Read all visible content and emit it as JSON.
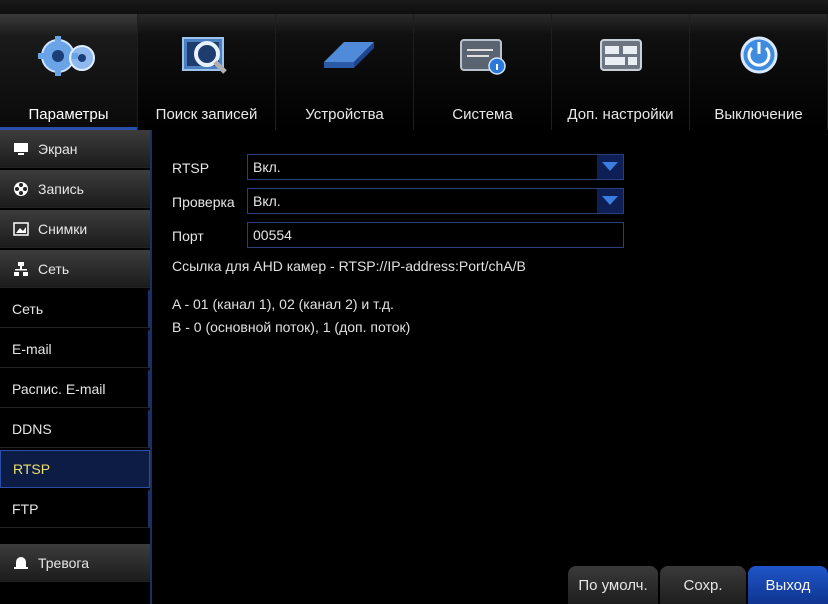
{
  "tabs": [
    {
      "label": "Параметры",
      "icon": "gears-icon",
      "active": true
    },
    {
      "label": "Поиск записей",
      "icon": "magnifier-film-icon"
    },
    {
      "label": "Устройства",
      "icon": "hard-drive-icon"
    },
    {
      "label": "Система",
      "icon": "system-info-icon"
    },
    {
      "label": "Доп. настройки",
      "icon": "advanced-settings-icon"
    },
    {
      "label": "Выключение",
      "icon": "power-icon"
    }
  ],
  "sidebar": {
    "items": [
      {
        "label": "Экран",
        "type": "category",
        "icon": "monitor-icon"
      },
      {
        "label": "Запись",
        "type": "category",
        "icon": "film-reel-icon"
      },
      {
        "label": "Снимки",
        "type": "category",
        "icon": "snapshot-icon"
      },
      {
        "label": "Сеть",
        "type": "category",
        "icon": "network-icon"
      },
      {
        "label": "Сеть",
        "type": "sub"
      },
      {
        "label": "E-mail",
        "type": "sub"
      },
      {
        "label": "Распис. E-mail",
        "type": "sub"
      },
      {
        "label": "DDNS",
        "type": "sub"
      },
      {
        "label": "RTSP",
        "type": "sub",
        "active": true
      },
      {
        "label": "FTP",
        "type": "sub"
      },
      {
        "label": "Тревога",
        "type": "category",
        "icon": "bell-icon"
      }
    ]
  },
  "form": {
    "rtsp_label": "RTSP",
    "rtsp_value": "Вкл.",
    "auth_label": "Проверка",
    "auth_value": "Вкл.",
    "port_label": "Порт",
    "port_value": "00554"
  },
  "notes": {
    "link": "Ссылка для AHD камер - RTSP://IP-address:Port/chA/B",
    "channel": "A - 01 (канал 1), 02 (канал 2) и т.д.",
    "stream": "B - 0 (основной поток), 1 (доп. поток)"
  },
  "buttons": {
    "default": "По умолч.",
    "save": "Сохр.",
    "exit": "Выход"
  },
  "colors": {
    "accent": "#1f55c8",
    "active_text": "#e8e06a",
    "border": "#2a3f7a"
  }
}
